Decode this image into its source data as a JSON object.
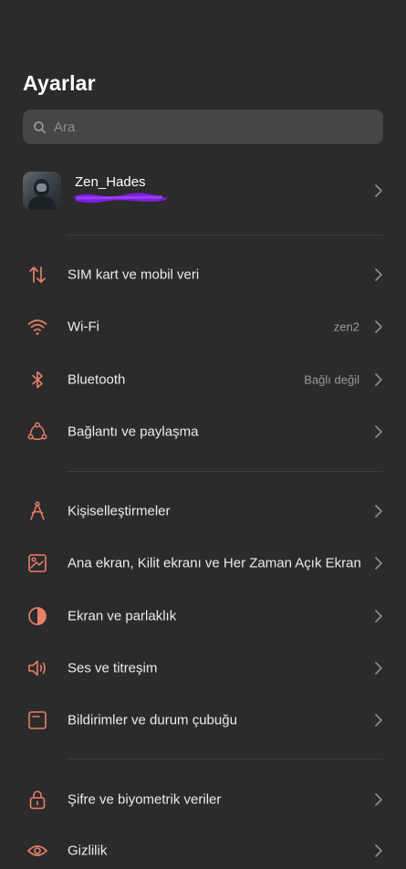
{
  "header": {
    "title": "Ayarlar"
  },
  "search": {
    "placeholder": "Ara"
  },
  "profile": {
    "name": "Zen_Hades"
  },
  "sections": [
    {
      "items": [
        {
          "icon": "sim-data-icon",
          "label": "SIM kart ve mobil veri",
          "value": ""
        },
        {
          "icon": "wifi-icon",
          "label": "Wi-Fi",
          "value": "zen2"
        },
        {
          "icon": "bluetooth-icon",
          "label": "Bluetooth",
          "value": "Bağlı değil"
        },
        {
          "icon": "connection-sharing-icon",
          "label": "Bağlantı ve paylaşma",
          "value": ""
        }
      ]
    },
    {
      "items": [
        {
          "icon": "personalization-icon",
          "label": "Kişiselleştirmeler",
          "value": ""
        },
        {
          "icon": "home-screen-icon",
          "label": "Ana ekran, Kilit ekranı ve Her Zaman Açık Ekran",
          "value": ""
        },
        {
          "icon": "display-brightness-icon",
          "label": "Ekran ve parlaklık",
          "value": ""
        },
        {
          "icon": "sound-vibration-icon",
          "label": "Ses ve titreşim",
          "value": ""
        },
        {
          "icon": "notifications-status-bar-icon",
          "label": "Bildirimler ve durum çubuğu",
          "value": ""
        }
      ]
    },
    {
      "items": [
        {
          "icon": "lock-icon",
          "label": "Şifre ve biyometrik veriler",
          "value": ""
        },
        {
          "icon": "privacy-eye-icon",
          "label": "Gizlilik",
          "value": ""
        }
      ]
    }
  ],
  "colors": {
    "background": "#2b2b2b",
    "accent_icon": "#e8806b",
    "search_bg": "#464646",
    "value_text": "#9a9a9a"
  }
}
